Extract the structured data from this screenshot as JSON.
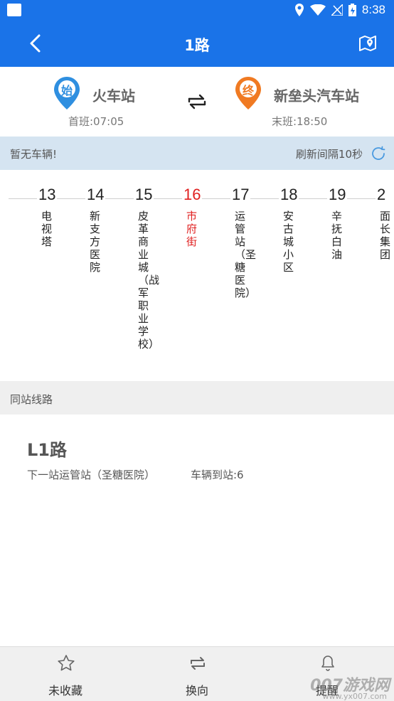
{
  "status_bar": {
    "time": "8:38"
  },
  "app_bar": {
    "title": "1路"
  },
  "route": {
    "start_badge": "始",
    "start_name": "火车站",
    "start_time": "首班:07:05",
    "end_badge": "终",
    "end_name": "新垒头汽车站",
    "end_time": "末班:18:50"
  },
  "info": {
    "no_vehicle": "暂无车辆!",
    "refresh": "刷新间隔10秒"
  },
  "stations": [
    {
      "num": "13",
      "name": "电视塔"
    },
    {
      "num": "14",
      "name": "新支方医院"
    },
    {
      "num": "15",
      "name": "皮革商业城（战军职业学校）"
    },
    {
      "num": "16",
      "name": "市府街",
      "active": true
    },
    {
      "num": "17",
      "name": "运管站（圣糖医院）"
    },
    {
      "num": "18",
      "name": "安古城小区"
    },
    {
      "num": "19",
      "name": "辛抚白油"
    },
    {
      "num": "2",
      "name": "面长集团"
    }
  ],
  "same_station": {
    "header": "同站线路",
    "line_name": "L1路",
    "next_stop": "下一站运管站（圣糖医院）",
    "arrival": "车辆到站:6"
  },
  "bottom_nav": {
    "favorite": "未收藏",
    "reverse": "换向",
    "remind": "提醒"
  },
  "watermark": {
    "main": "007游戏网",
    "sub": "www.yx007.com"
  },
  "colors": {
    "primary": "#1a73e8",
    "start_pin": "#2f8fe0",
    "end_pin": "#f07a22",
    "active_station": "#e02020"
  }
}
